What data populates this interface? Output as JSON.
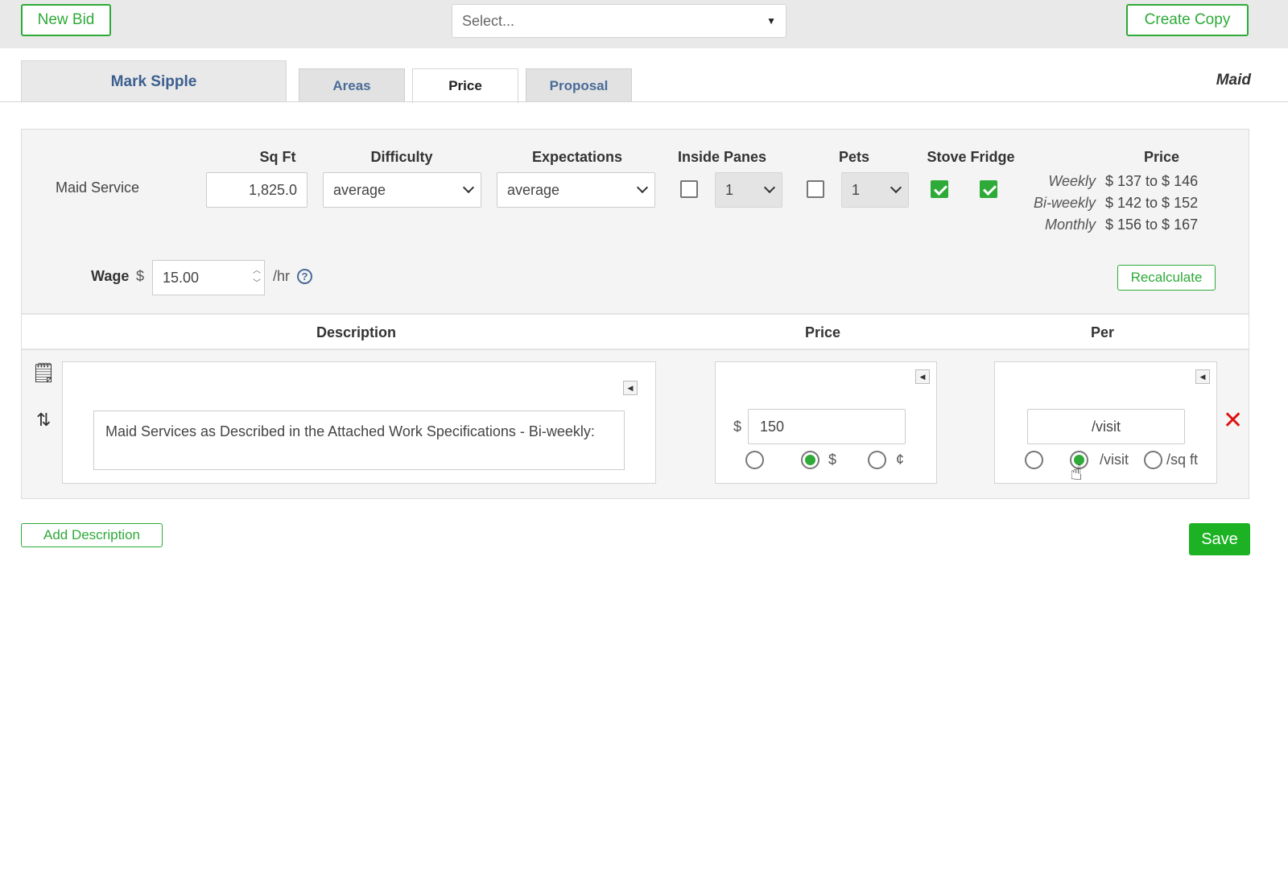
{
  "topbar": {
    "new_bid": "New Bid",
    "select_placeholder": "Select...",
    "create_copy": "Create Copy"
  },
  "tabs": {
    "customer": "Mark Sipple",
    "items": [
      {
        "label": "Areas",
        "active": false
      },
      {
        "label": "Price",
        "active": true
      },
      {
        "label": "Proposal",
        "active": false
      }
    ],
    "service_type": "Maid"
  },
  "service": {
    "label": "Maid Service",
    "headers": {
      "sqft": "Sq Ft",
      "difficulty": "Difficulty",
      "expectations": "Expectations",
      "inside_panes": "Inside Panes",
      "pets": "Pets",
      "stove_fridge": "Stove Fridge",
      "price": "Price"
    },
    "sqft": "1,825.0",
    "difficulty": "average",
    "expectations": "average",
    "inside_panes_checked": false,
    "inside_panes_count": "1",
    "pets_checked": false,
    "pets_count": "1",
    "stove_checked": true,
    "fridge_checked": true,
    "price_ranges": [
      {
        "period": "Weekly",
        "range": "$ 137 to $ 146"
      },
      {
        "period": "Bi-weekly",
        "range": "$ 142 to $ 152"
      },
      {
        "period": "Monthly",
        "range": "$ 156 to $ 167"
      }
    ],
    "wage_label": "Wage",
    "wage_currency": "$",
    "wage": "15.00",
    "wage_unit": "/hr",
    "recalculate": "Recalculate"
  },
  "table": {
    "headers": {
      "description": "Description",
      "price": "Price",
      "per": "Per"
    },
    "rows": [
      {
        "description": "Maid Services as Described in the Attached Work Specifications - Bi-weekly:",
        "price_currency": "$",
        "price": "150",
        "price_unit_options": [
          "",
          "$",
          "¢"
        ],
        "price_unit_selected": 1,
        "per": "/visit",
        "per_options": [
          "",
          "/visit",
          "/sq ft"
        ],
        "per_selected": 1
      }
    ]
  },
  "actions": {
    "add_description": "Add Description",
    "save": "Save"
  },
  "colors": {
    "accent_green": "#2eaa38",
    "save_green": "#1db224",
    "tab_blue": "#4a6b98",
    "delete_red": "#dd1111"
  }
}
